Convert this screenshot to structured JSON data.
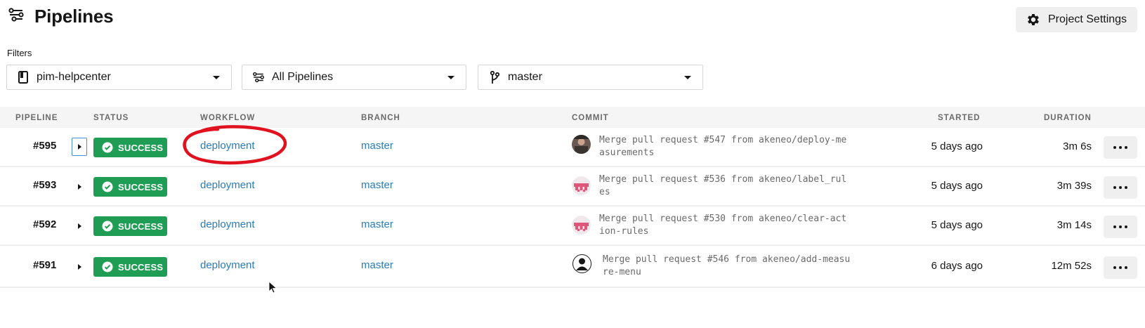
{
  "header": {
    "title": "Pipelines",
    "title_icon": "pipelines-icon",
    "settings_button": {
      "label": "Project Settings",
      "icon": "gear-icon"
    }
  },
  "filters": {
    "label": "Filters",
    "project": {
      "value": "pim-helpcenter",
      "icon": "repository-icon"
    },
    "workflow": {
      "value": "All Pipelines",
      "icon": "pipelines-icon"
    },
    "branch": {
      "value": "master",
      "icon": "git-branch-icon"
    }
  },
  "table": {
    "columns": {
      "pipeline": "PIPELINE",
      "status": "STATUS",
      "workflow": "WORKFLOW",
      "branch": "BRANCH",
      "commit": "COMMIT",
      "started": "STARTED",
      "duration": "DURATION"
    },
    "rows": [
      {
        "pipeline": "#595",
        "status": "SUCCESS",
        "workflow": "deployment",
        "branch": "master",
        "commit_line1": "Merge pull request #547 from akeneo/deploy-me",
        "commit_line2": "asurements",
        "avatar": "photo-avatar",
        "started": "5 days ago",
        "duration": "3m 6s"
      },
      {
        "pipeline": "#593",
        "status": "SUCCESS",
        "workflow": "deployment",
        "branch": "master",
        "commit_line1": "Merge pull request #536 from akeneo/label_rul",
        "commit_line2": "es",
        "avatar": "identicon-avatar",
        "started": "5 days ago",
        "duration": "3m 39s"
      },
      {
        "pipeline": "#592",
        "status": "SUCCESS",
        "workflow": "deployment",
        "branch": "master",
        "commit_line1": "Merge pull request #530 from akeneo/clear-act",
        "commit_line2": "ion-rules",
        "avatar": "identicon-avatar",
        "started": "5 days ago",
        "duration": "3m 14s"
      },
      {
        "pipeline": "#591",
        "status": "SUCCESS",
        "workflow": "deployment",
        "branch": "master",
        "commit_line1": "Merge pull request #546 from akeneo/add-measu",
        "commit_line2": "re-menu",
        "avatar": "default-user-avatar",
        "started": "6 days ago",
        "duration": "12m 52s"
      }
    ]
  },
  "colors": {
    "success_green": "#1f9d55",
    "link_blue": "#2b7bb9",
    "annotation_red": "#e0121f",
    "identicon_pink": "#e0557a"
  }
}
